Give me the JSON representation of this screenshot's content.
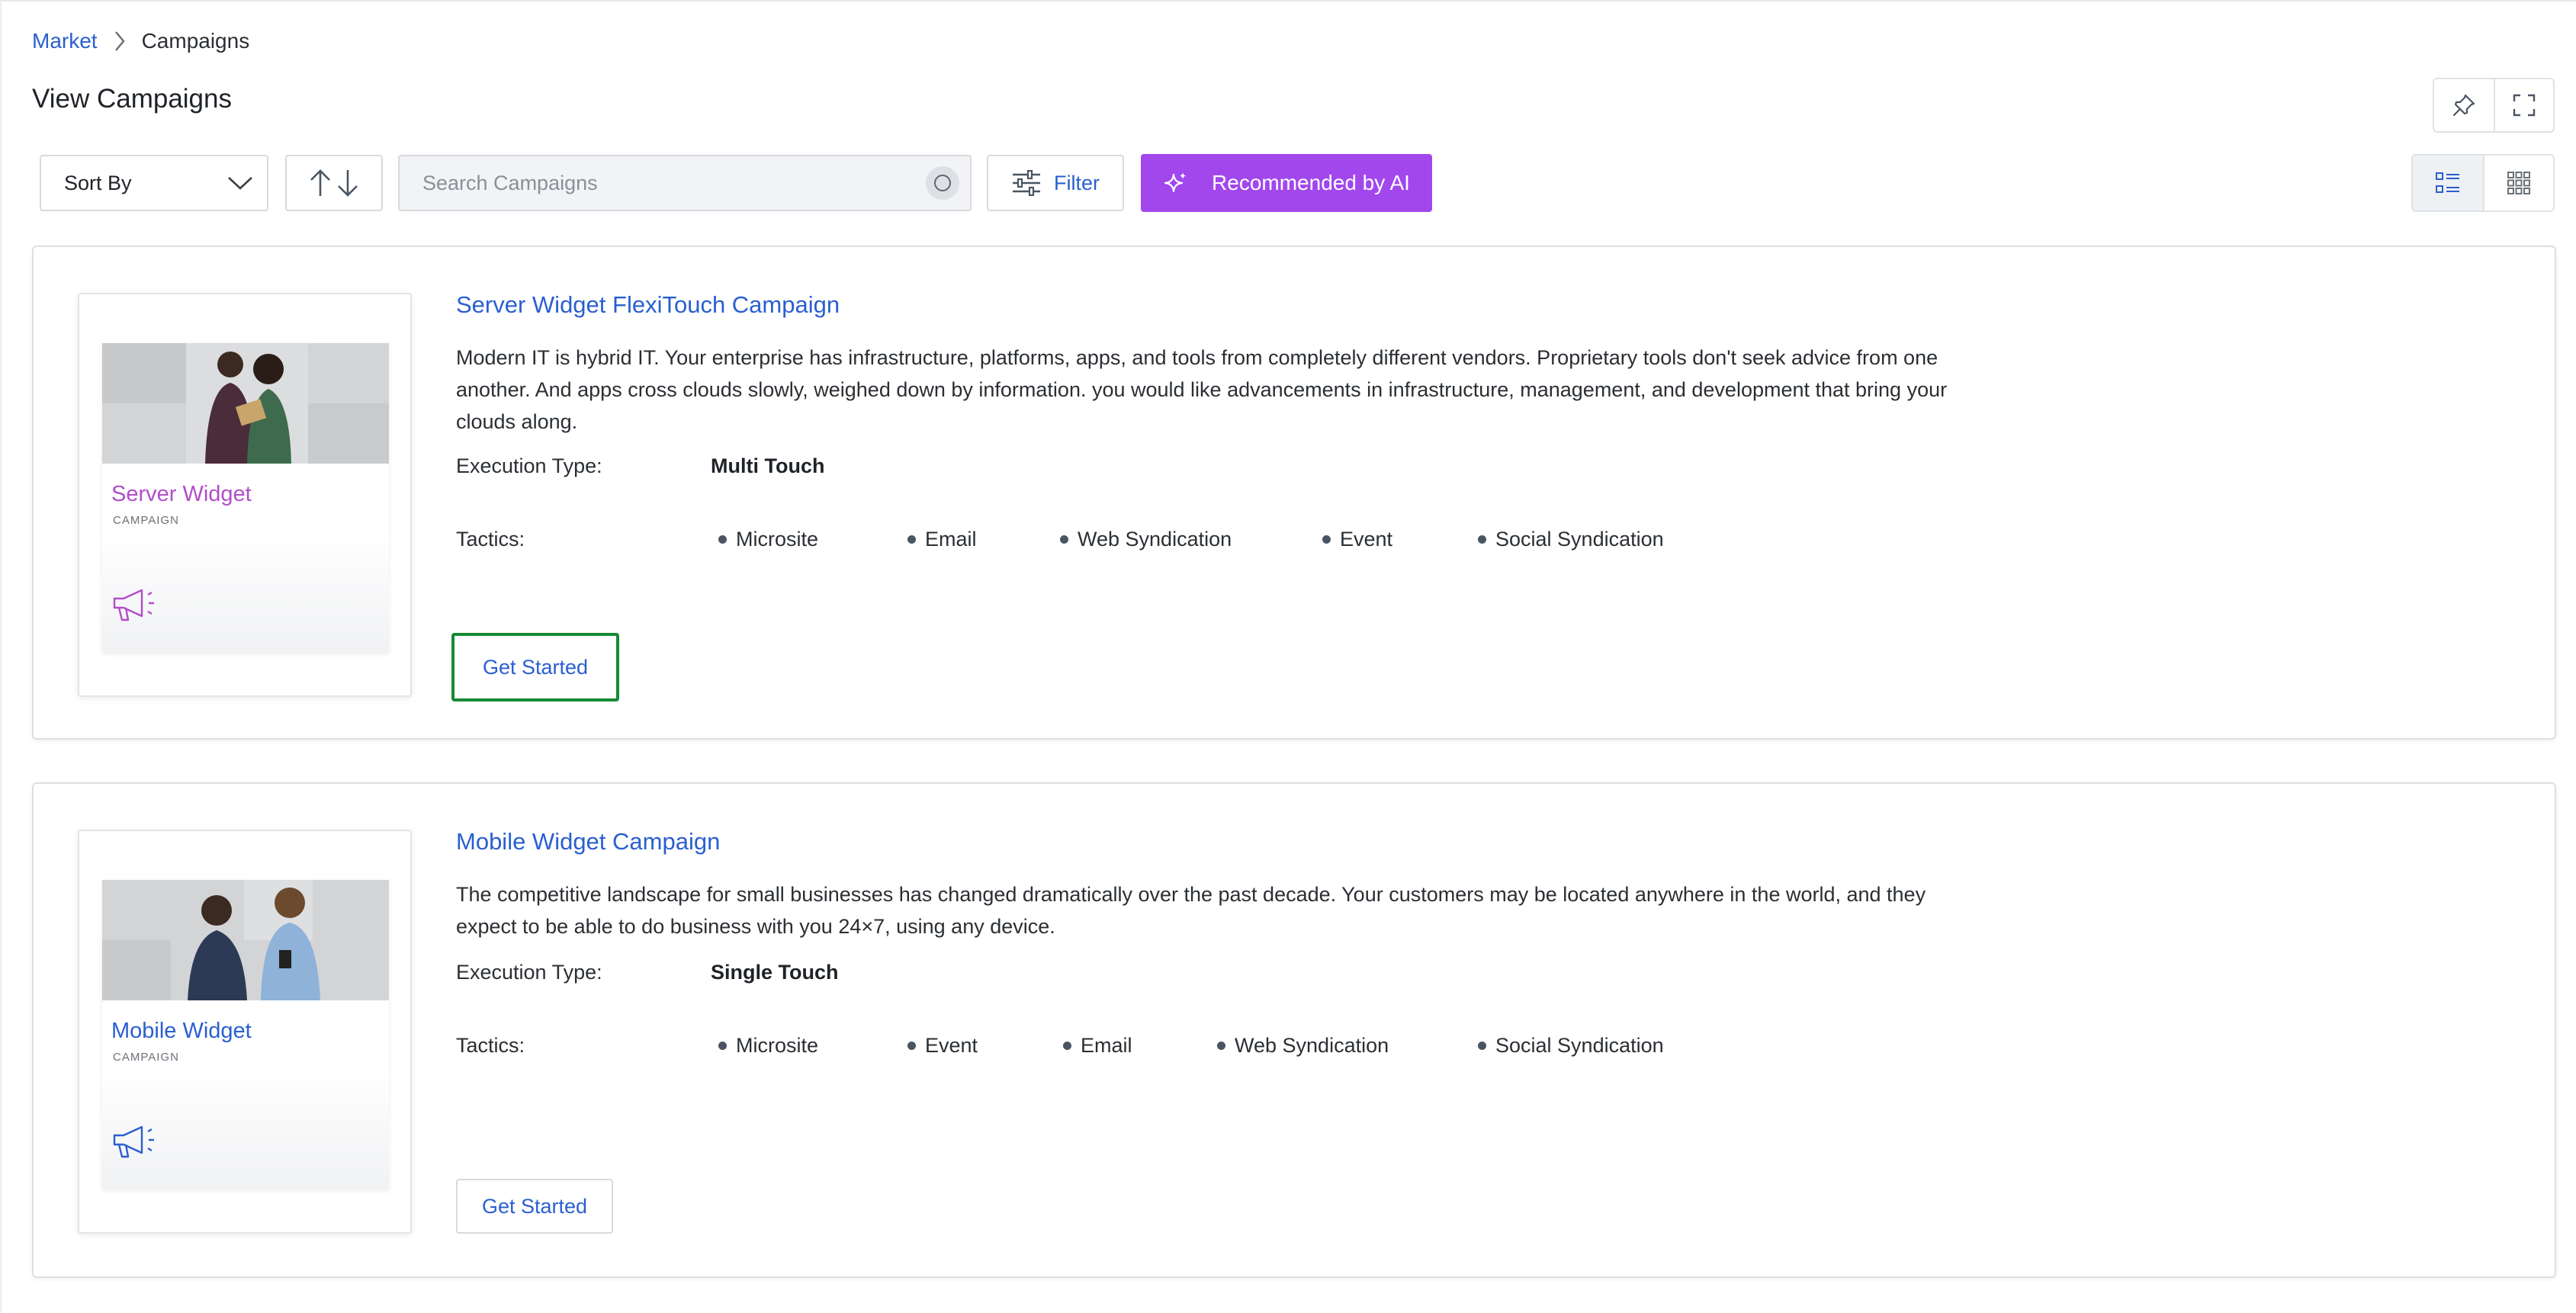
{
  "breadcrumb": {
    "root": "Market",
    "current": "Campaigns"
  },
  "page": {
    "title": "View Campaigns"
  },
  "toolbar": {
    "sort_label": "Sort By",
    "search_placeholder": "Search Campaigns",
    "filter_label": "Filter",
    "ai_label": "Recommended by AI"
  },
  "colors": {
    "link": "#2a5fd0",
    "ai_button": "#a147ec",
    "focus_outline": "#168a36",
    "server_accent": "#b24ec9",
    "mobile_accent": "#2a5fd0"
  },
  "campaigns": [
    {
      "title": "Server Widget FlexiTouch Campaign",
      "description": "Modern IT is hybrid IT. Your enterprise has infrastructure, platforms, apps, and tools from completely different vendors. Proprietary tools don't seek advice from one another. And apps cross clouds slowly, weighed down by information. you would like advancements in infrastructure, management, and development that bring your clouds along.",
      "thumb_name": "Server Widget",
      "thumb_sub": "CAMPAIGN",
      "execution_label": "Execution Type:",
      "execution_value": "Multi Touch",
      "tactics_label": "Tactics:",
      "tactics": [
        "Microsite",
        "Email",
        "Web Syndication",
        "Event",
        "Social Syndication"
      ],
      "cta": "Get Started"
    },
    {
      "title": "Mobile Widget Campaign",
      "description": "The competitive landscape for small businesses has changed dramatically over the past decade. Your customers may be located anywhere in the world, and they expect to be able to do business with you 24×7, using any device.",
      "thumb_name": "Mobile Widget",
      "thumb_sub": "CAMPAIGN",
      "execution_label": "Execution Type:",
      "execution_value": "Single Touch",
      "tactics_label": "Tactics:",
      "tactics": [
        "Microsite",
        "Event",
        "Email",
        "Web Syndication",
        "Social Syndication"
      ],
      "cta": "Get Started"
    }
  ]
}
